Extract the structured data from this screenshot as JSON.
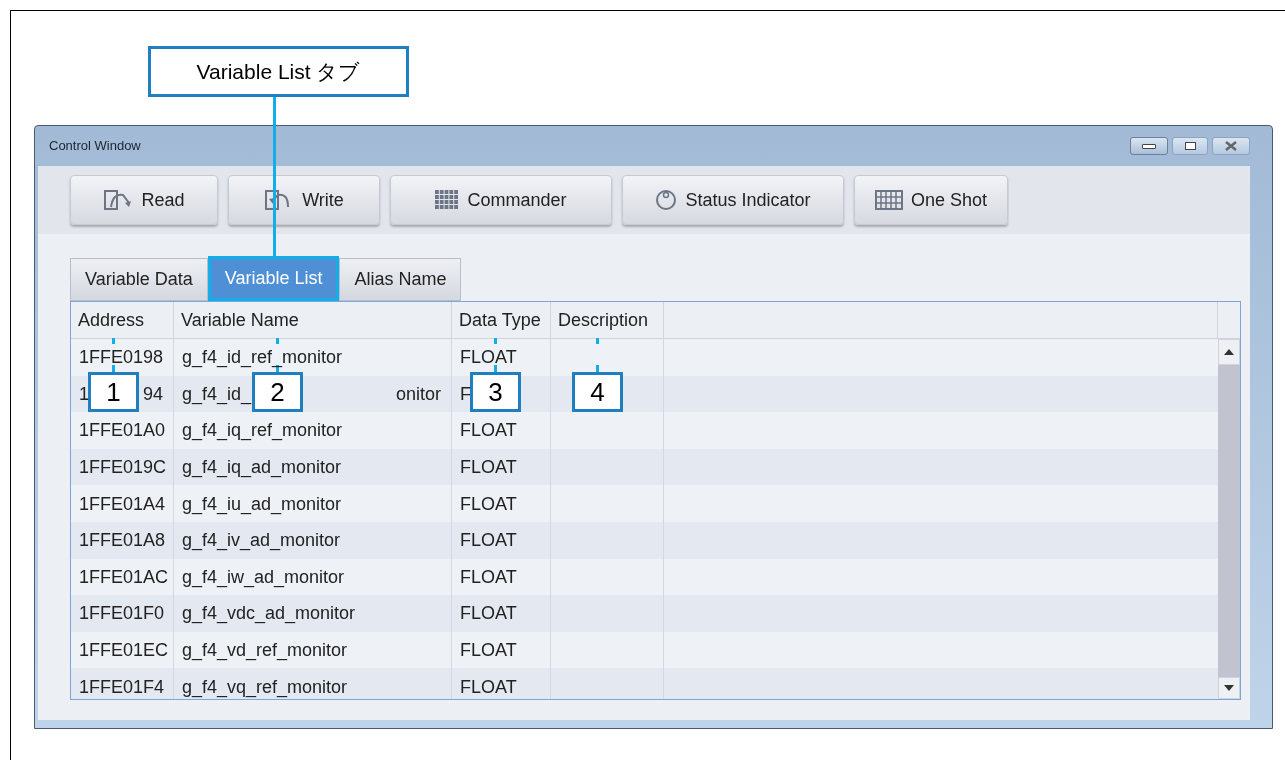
{
  "callout_tab": {
    "label": "Variable List タブ"
  },
  "window": {
    "title": "Control Window"
  },
  "toolbar": [
    {
      "kind": "read",
      "label": "Read"
    },
    {
      "kind": "write",
      "label": "Write"
    },
    {
      "kind": "commander",
      "label": "Commander"
    },
    {
      "kind": "status",
      "label": "Status Indicator"
    },
    {
      "kind": "oneshot",
      "label": "One Shot"
    }
  ],
  "tabs": [
    {
      "label": "Variable Data",
      "selected": false
    },
    {
      "label": "Variable List",
      "selected": true
    },
    {
      "label": "Alias Name",
      "selected": false
    }
  ],
  "table": {
    "columns": [
      "Address",
      "Variable Name",
      "Data Type",
      "Description"
    ],
    "rows": [
      {
        "address": [
          "1FFE0198"
        ],
        "name": [
          "g_f4_id_ref_monitor"
        ],
        "type": [
          "FLOAT"
        ]
      },
      {
        "address": [
          "1",
          "94"
        ],
        "name": [
          "g_f4_id_",
          "onitor"
        ],
        "type": [
          "F"
        ]
      },
      {
        "address": [
          "1FFE01A0"
        ],
        "name": [
          "g_f4_iq_ref_monitor"
        ],
        "type": [
          "FLOAT"
        ]
      },
      {
        "address": [
          "1FFE019C"
        ],
        "name": [
          "g_f4_iq_ad_monitor"
        ],
        "type": [
          "FLOAT"
        ]
      },
      {
        "address": [
          "1FFE01A4"
        ],
        "name": [
          "g_f4_iu_ad_monitor"
        ],
        "type": [
          "FLOAT"
        ]
      },
      {
        "address": [
          "1FFE01A8"
        ],
        "name": [
          "g_f4_iv_ad_monitor"
        ],
        "type": [
          "FLOAT"
        ]
      },
      {
        "address": [
          "1FFE01AC"
        ],
        "name": [
          "g_f4_iw_ad_monitor"
        ],
        "type": [
          "FLOAT"
        ]
      },
      {
        "address": [
          "1FFE01F0"
        ],
        "name": [
          "g_f4_vdc_ad_monitor"
        ],
        "type": [
          "FLOAT"
        ]
      },
      {
        "address": [
          "1FFE01EC"
        ],
        "name": [
          "g_f4_vd_ref_monitor"
        ],
        "type": [
          "FLOAT"
        ]
      },
      {
        "address": [
          "1FFE01F4"
        ],
        "name": [
          "g_f4_vq_ref_monitor"
        ],
        "type": [
          "FLOAT"
        ]
      }
    ]
  },
  "markers": [
    "1",
    "2",
    "3",
    "4"
  ]
}
